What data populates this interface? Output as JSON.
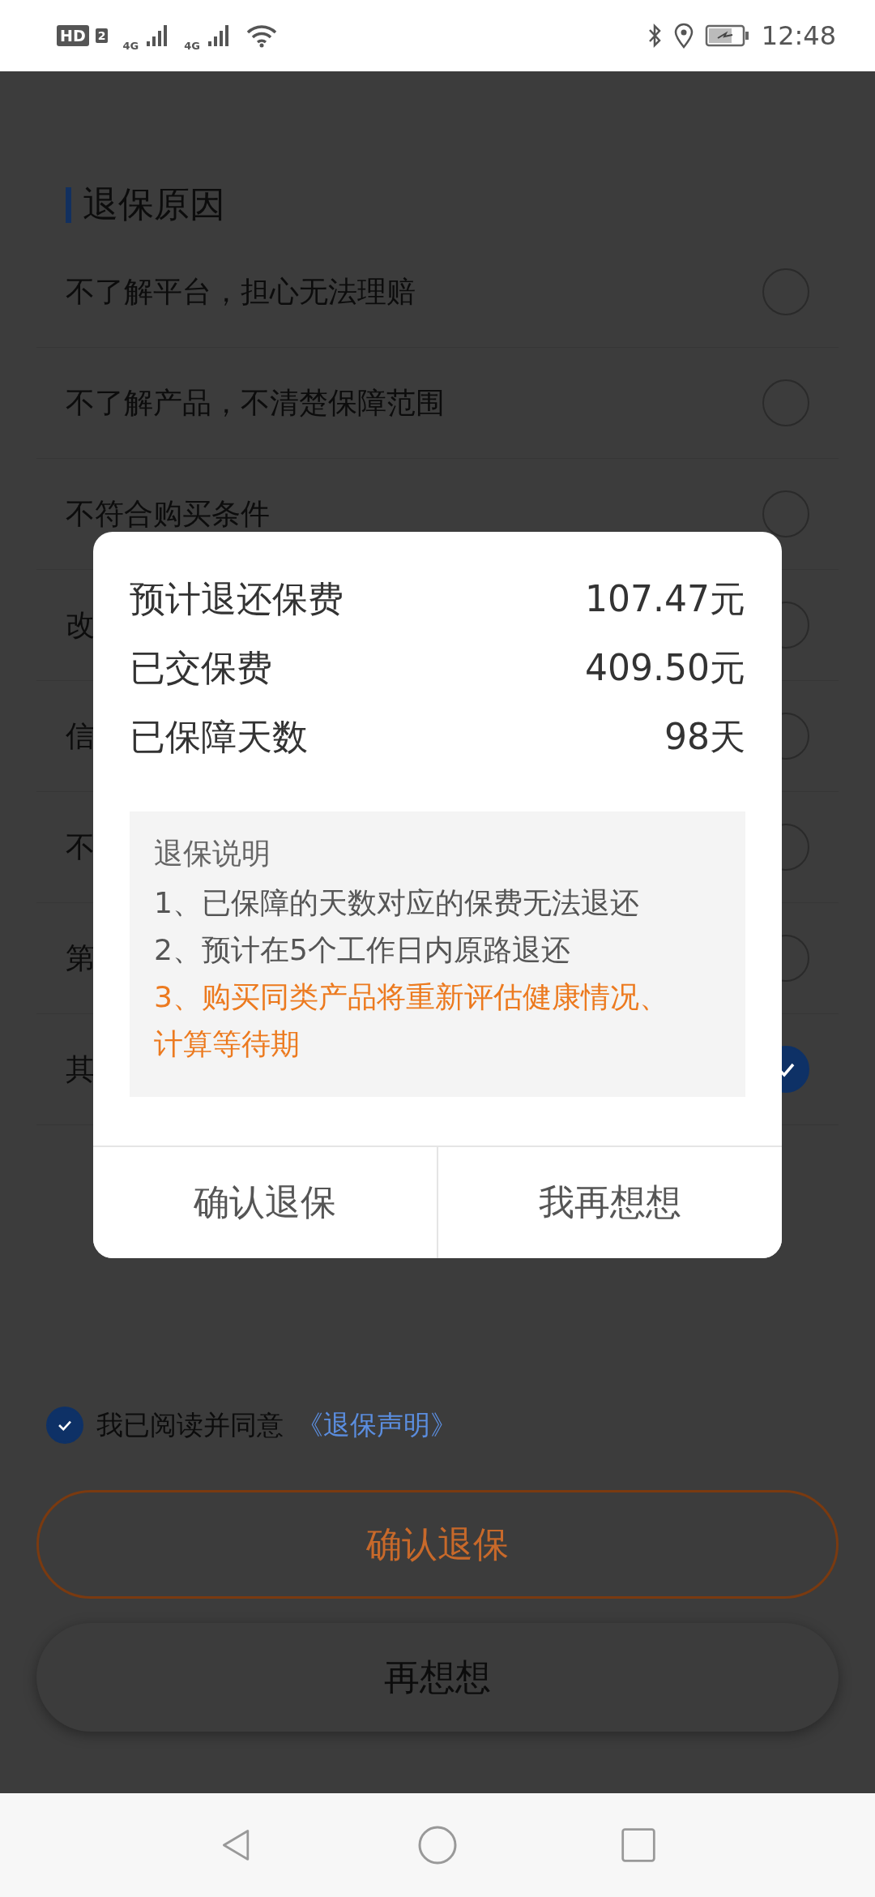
{
  "status_bar": {
    "hd": "HD",
    "hd_slot": "2",
    "networks": [
      "4G",
      "4G"
    ],
    "time": "12:48"
  },
  "section_title": "退保原因",
  "reasons": [
    {
      "label": "不了解平台，担心无法理赔",
      "selected": false
    },
    {
      "label": "不了解产品，不清楚保障范围",
      "selected": false
    },
    {
      "label": "不符合购买条件",
      "selected": false
    },
    {
      "label": "改",
      "selected": false
    },
    {
      "label": "信",
      "selected": false
    },
    {
      "label": "不",
      "selected": false
    },
    {
      "label": "第",
      "selected": false
    },
    {
      "label": "其",
      "selected": true
    }
  ],
  "agreement": {
    "checked": true,
    "text": "我已阅读并同意",
    "link": "《退保声明》"
  },
  "buttons": [
    {
      "label": "确认退保",
      "kind": "primary"
    },
    {
      "label": "再想想",
      "kind": "secondary"
    }
  ],
  "dialog": {
    "rows": [
      {
        "label": "预计退还保费",
        "value": "107.47元"
      },
      {
        "label": "已交保费",
        "value": "409.50元"
      },
      {
        "label": "已保障天数",
        "value": "98天"
      }
    ],
    "note": {
      "title": "退保说明",
      "items": [
        {
          "text": "1、已保障的天数对应的保费无法退还",
          "highlight": false
        },
        {
          "text": "2、预计在5个工作日内原路退还",
          "highlight": false
        },
        {
          "text": "3、购买同类产品将重新评估健康情况、计算等待期",
          "highlight": true
        }
      ]
    },
    "actions": [
      "确认退保",
      "我再想想"
    ]
  }
}
